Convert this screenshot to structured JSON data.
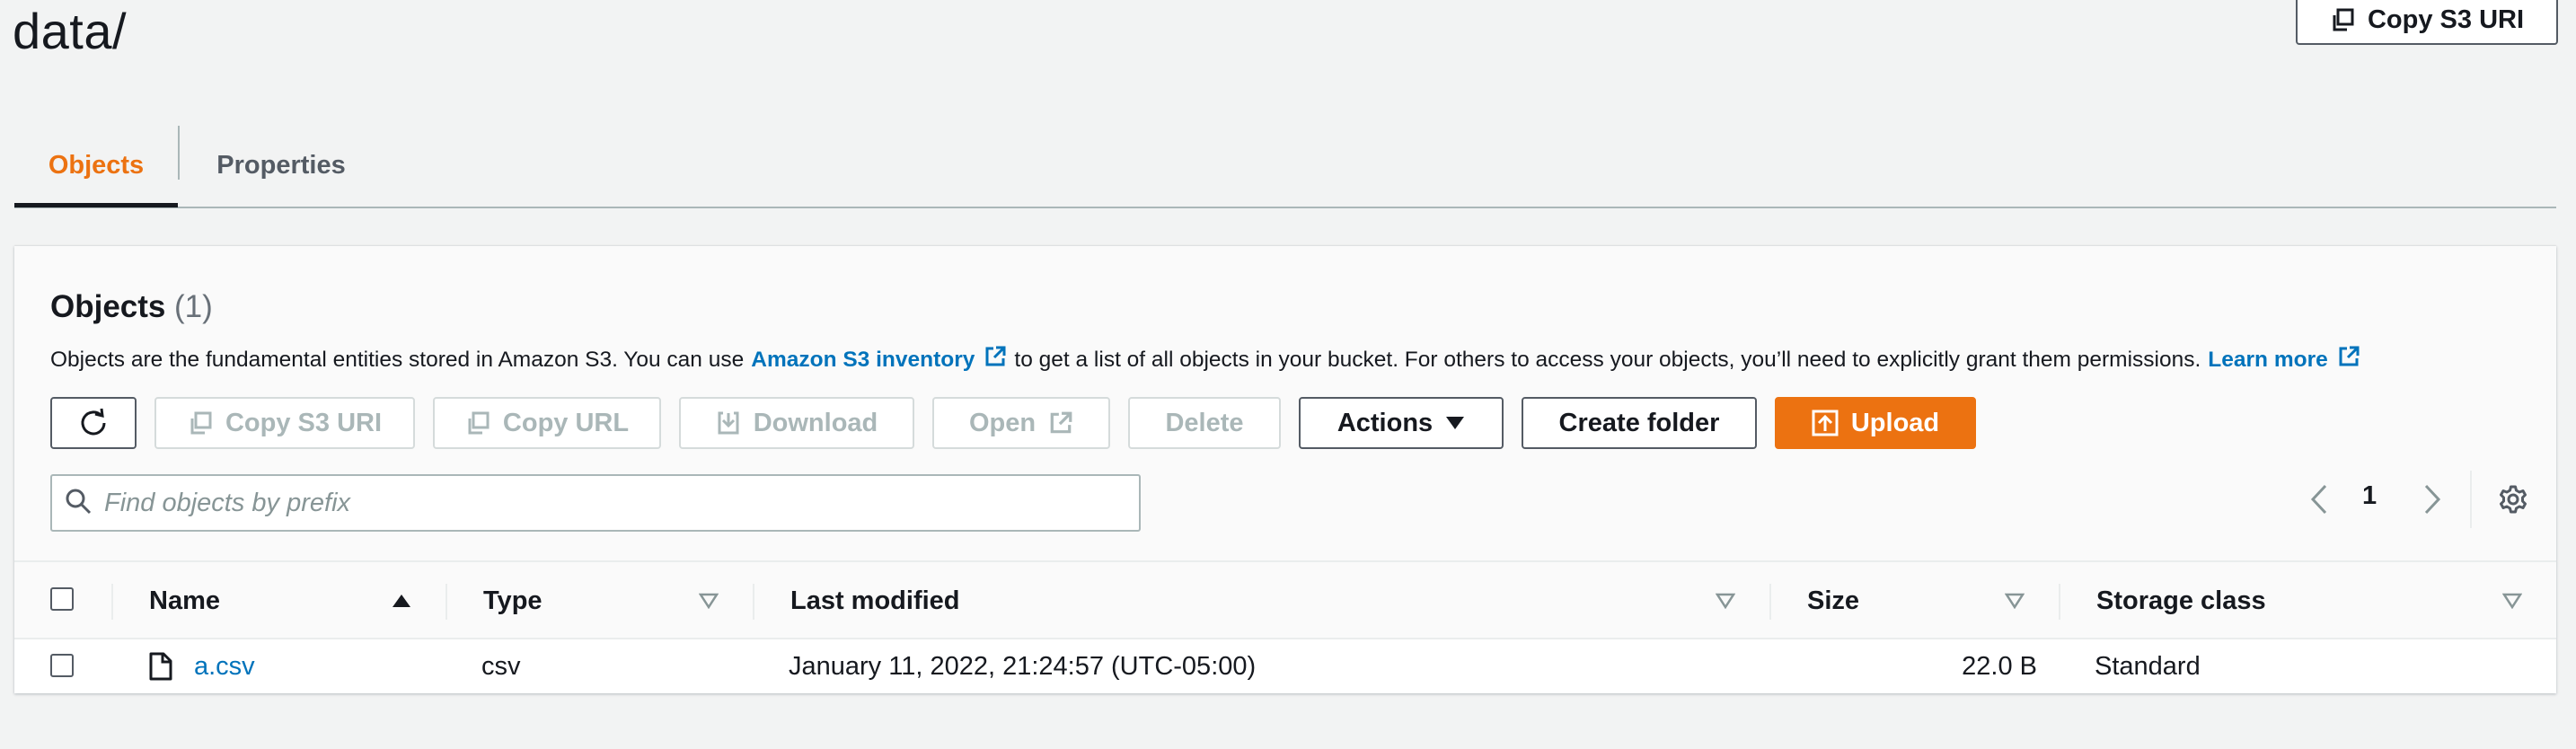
{
  "page": {
    "title": "data/"
  },
  "header": {
    "copy_uri_label": "Copy S3 URI"
  },
  "tabs": [
    {
      "label": "Objects",
      "active": true
    },
    {
      "label": "Properties",
      "active": false
    }
  ],
  "objects_panel": {
    "title": "Objects",
    "count": "(1)",
    "description": {
      "text_1": "Objects are the fundamental entities stored in Amazon S3. You can use",
      "link_1": "Amazon S3 inventory",
      "text_2": "to get a list of all objects in your bucket. For others to access your objects, you’ll need to explicitly grant them permissions.",
      "link_2": "Learn more"
    },
    "toolbar": {
      "copy_s3_uri": "Copy S3 URI",
      "copy_url": "Copy URL",
      "download": "Download",
      "open": "Open",
      "delete": "Delete",
      "actions": "Actions",
      "create_folder": "Create folder",
      "upload": "Upload"
    },
    "search": {
      "placeholder": "Find objects by prefix",
      "value": ""
    },
    "pagination": {
      "current_page": "1"
    },
    "table": {
      "columns": [
        "Name",
        "Type",
        "Last modified",
        "Size",
        "Storage class"
      ],
      "sort": {
        "column": "Name",
        "direction": "ascending"
      },
      "rows": [
        {
          "name": "a.csv",
          "icon": "file-icon",
          "type": "csv",
          "last_modified": "January 11, 2022, 21:24:57 (UTC-05:00)",
          "size": "22.0 B",
          "storage_class": "Standard"
        }
      ]
    }
  },
  "colors": {
    "accent_orange": "#ec7211",
    "link_blue": "#0073bb",
    "text": "#16191f",
    "disabled_text": "#aab7b8",
    "background": "#f2f3f3"
  }
}
